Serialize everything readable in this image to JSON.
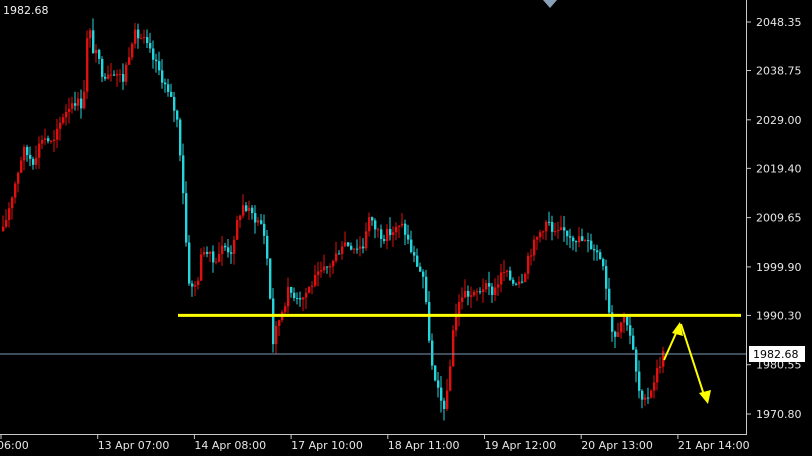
{
  "chart_data": {
    "type": "candlestick",
    "symbol_price": "1982.68",
    "current_price": 1982.68,
    "current_price_label": "1982.68",
    "y_ticks": [
      "2048.35",
      "2038.75",
      "2029.00",
      "2019.40",
      "2009.65",
      "1999.90",
      "1990.30",
      "1980.55",
      "1970.80"
    ],
    "y_tick_values": [
      2048.35,
      2038.75,
      2029.0,
      2019.4,
      2009.65,
      1999.9,
      1990.3,
      1980.55,
      1970.8
    ],
    "ylim": [
      1967.0,
      2052.0
    ],
    "x_ticks": [
      "06:00",
      "13 Apr 07:00",
      "14 Apr 08:00",
      "17 Apr 10:00",
      "18 Apr 11:00",
      "19 Apr 12:00",
      "20 Apr 13:00",
      "21 Apr 14:00"
    ],
    "support_level": 1990.3,
    "up_color": "#e01010",
    "down_color": "#26d4dc",
    "support_color": "#ffff00",
    "arrow_color": "#ffff00",
    "current_line_color": "#7a9bb5",
    "grid": false,
    "price_path": [
      [
        0,
        2007
      ],
      [
        10,
        2015
      ],
      [
        20,
        2023
      ],
      [
        30,
        2021
      ],
      [
        40,
        2026
      ],
      [
        50,
        2024
      ],
      [
        60,
        2030
      ],
      [
        70,
        2033
      ],
      [
        80,
        2032
      ],
      [
        85,
        2048
      ],
      [
        90,
        2043
      ],
      [
        95,
        2041
      ],
      [
        100,
        2038
      ],
      [
        110,
        2039
      ],
      [
        120,
        2037
      ],
      [
        130,
        2046
      ],
      [
        140,
        2045
      ],
      [
        150,
        2041
      ],
      [
        160,
        2037
      ],
      [
        165,
        2034
      ],
      [
        170,
        2032
      ],
      [
        175,
        2028
      ],
      [
        180,
        2015
      ],
      [
        185,
        1998
      ],
      [
        190,
        1995
      ],
      [
        195,
        1998
      ],
      [
        200,
        2004
      ],
      [
        210,
        2001
      ],
      [
        220,
        2004
      ],
      [
        230,
        2003
      ],
      [
        235,
        2010
      ],
      [
        240,
        2012
      ],
      [
        250,
        2010
      ],
      [
        260,
        2008
      ],
      [
        265,
        2000
      ],
      [
        270,
        1985
      ],
      [
        275,
        1989
      ],
      [
        285,
        1995
      ],
      [
        300,
        1994
      ],
      [
        310,
        1997
      ],
      [
        320,
        1999
      ],
      [
        330,
        2001
      ],
      [
        340,
        2005
      ],
      [
        350,
        2004
      ],
      [
        360,
        2004
      ],
      [
        365,
        2010
      ],
      [
        370,
        2008
      ],
      [
        380,
        2006
      ],
      [
        390,
        2007
      ],
      [
        400,
        2008
      ],
      [
        410,
        2002
      ],
      [
        420,
        1998
      ],
      [
        425,
        1988
      ],
      [
        430,
        1978
      ],
      [
        435,
        1975
      ],
      [
        440,
        1972
      ],
      [
        445,
        1975
      ],
      [
        450,
        1988
      ],
      [
        455,
        1992
      ],
      [
        460,
        1995
      ],
      [
        470,
        1994
      ],
      [
        480,
        1996
      ],
      [
        490,
        1995
      ],
      [
        500,
        1999
      ],
      [
        510,
        1997
      ],
      [
        520,
        1998
      ],
      [
        525,
        2002
      ],
      [
        530,
        2004
      ],
      [
        540,
        2008
      ],
      [
        545,
        2009
      ],
      [
        550,
        2006
      ],
      [
        560,
        2007
      ],
      [
        570,
        2006
      ],
      [
        580,
        2005
      ],
      [
        590,
        2004
      ],
      [
        600,
        2001
      ],
      [
        605,
        1993
      ],
      [
        610,
        1986
      ],
      [
        615,
        1988
      ],
      [
        620,
        1990
      ],
      [
        625,
        1989
      ],
      [
        630,
        1983
      ],
      [
        635,
        1976
      ],
      [
        640,
        1972
      ],
      [
        650,
        1977
      ],
      [
        655,
        1980
      ],
      [
        660,
        1982.68
      ]
    ]
  }
}
